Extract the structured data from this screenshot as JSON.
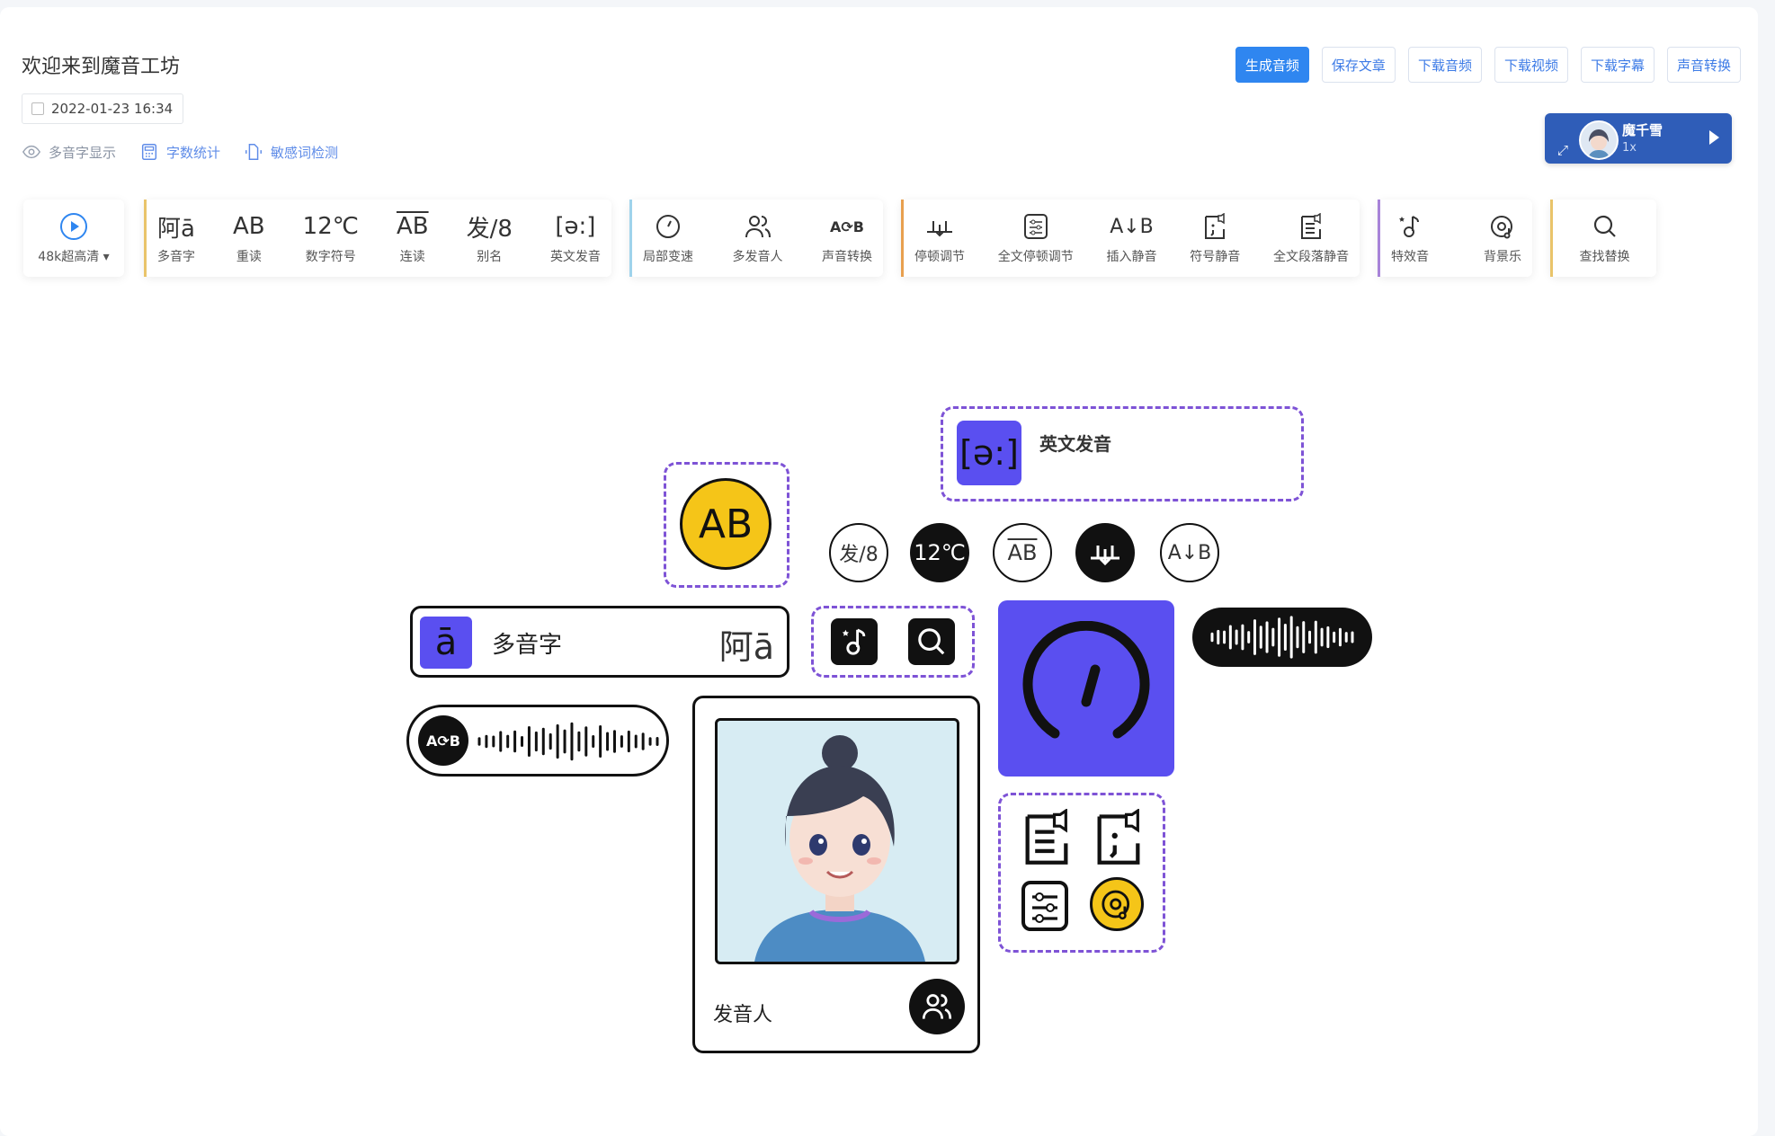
{
  "header": {
    "title": "欢迎来到魔音工坊",
    "date": "2022-01-23 16:34",
    "options": [
      {
        "label": "多音字显示",
        "icon": "eye-icon"
      },
      {
        "label": "字数统计",
        "icon": "calculator-icon"
      },
      {
        "label": "敏感词检测",
        "icon": "shield-scan-icon"
      }
    ],
    "actions": [
      "生成音频",
      "保存文章",
      "下载音频",
      "下载视频",
      "下载字幕",
      "声音转换"
    ]
  },
  "voice": {
    "name": "魔千雪",
    "speed": "1x"
  },
  "toolbar": {
    "quality": "48k超高清",
    "groups": [
      {
        "color": "#e9c46a",
        "items": [
          {
            "label": "多音字",
            "glyph": "阿ā"
          },
          {
            "label": "重读",
            "glyph": "AB"
          },
          {
            "label": "数字符号",
            "glyph": "12℃"
          },
          {
            "label": "连读",
            "glyph": "AB"
          },
          {
            "label": "别名",
            "glyph": "发/8"
          },
          {
            "label": "英文发音",
            "glyph": "[ə:]"
          }
        ]
      },
      {
        "color": "#9fd3ec",
        "items": [
          {
            "label": "局部变速",
            "glyph": "gauge"
          },
          {
            "label": "多发音人",
            "glyph": "people"
          },
          {
            "label": "声音转换",
            "glyph": "AB-swap"
          }
        ]
      },
      {
        "color": "#e8a04f",
        "items": [
          {
            "label": "停顿调节",
            "glyph": "pause"
          },
          {
            "label": "全文停顿调节",
            "glyph": "sliders"
          },
          {
            "label": "插入静音",
            "glyph": "A↓B"
          },
          {
            "label": "符号静音",
            "glyph": "mute-punct"
          },
          {
            "label": "全文段落静音",
            "glyph": "mute-para"
          }
        ]
      },
      {
        "color": "#a783d8",
        "items": [
          {
            "label": "特效音",
            "glyph": "note-star"
          },
          {
            "label": "背景乐",
            "glyph": "disc"
          }
        ]
      },
      {
        "color": "#e9c46a",
        "items": [
          {
            "label": "查找替换",
            "glyph": "search"
          }
        ]
      }
    ]
  },
  "illustration": {
    "english_label": "英文发音",
    "english_glyph": "[ə:]",
    "polyphone_label": "多音字",
    "polyphone_glyph": "ā",
    "polyphone_right": "阿ā",
    "speaker_label": "发音人",
    "ab": "AB",
    "temp": "12℃",
    "alias": "发/8",
    "link": "AB",
    "insert": "A↓B",
    "colors": {
      "purple": "#5a4ff0",
      "yellow": "#f5c518",
      "black": "#111111"
    }
  }
}
